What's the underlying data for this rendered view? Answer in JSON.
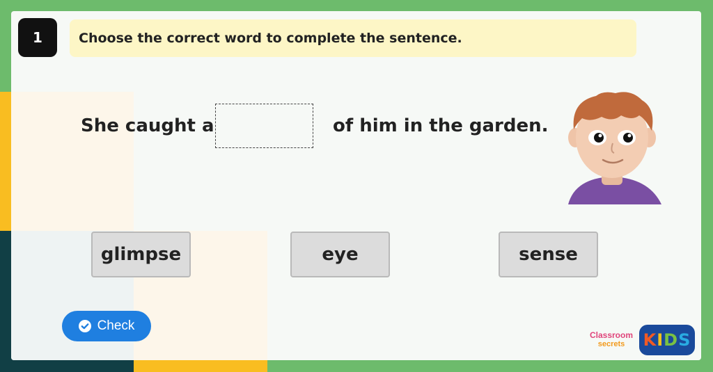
{
  "question": {
    "number": "1",
    "instruction": "Choose the correct word to complete the sentence."
  },
  "sentence": {
    "before": "She caught a",
    "after": "of him in the garden."
  },
  "options": [
    {
      "label": "glimpse"
    },
    {
      "label": "eye"
    },
    {
      "label": "sense"
    }
  ],
  "check_button": {
    "label": "Check",
    "icon": "check-circle-icon"
  },
  "branding": {
    "classroom_line1": "Classroom",
    "classroom_line2": "secrets",
    "kids": [
      "K",
      "I",
      "D",
      "S"
    ]
  },
  "colors": {
    "frame_green": "#6dbb6c",
    "accent_yellow": "#f9bd21",
    "accent_dark": "#113f45",
    "check_blue": "#1f7fe0",
    "instruction_bg": "#fdf6c6",
    "option_bg": "#dcdcdc"
  }
}
